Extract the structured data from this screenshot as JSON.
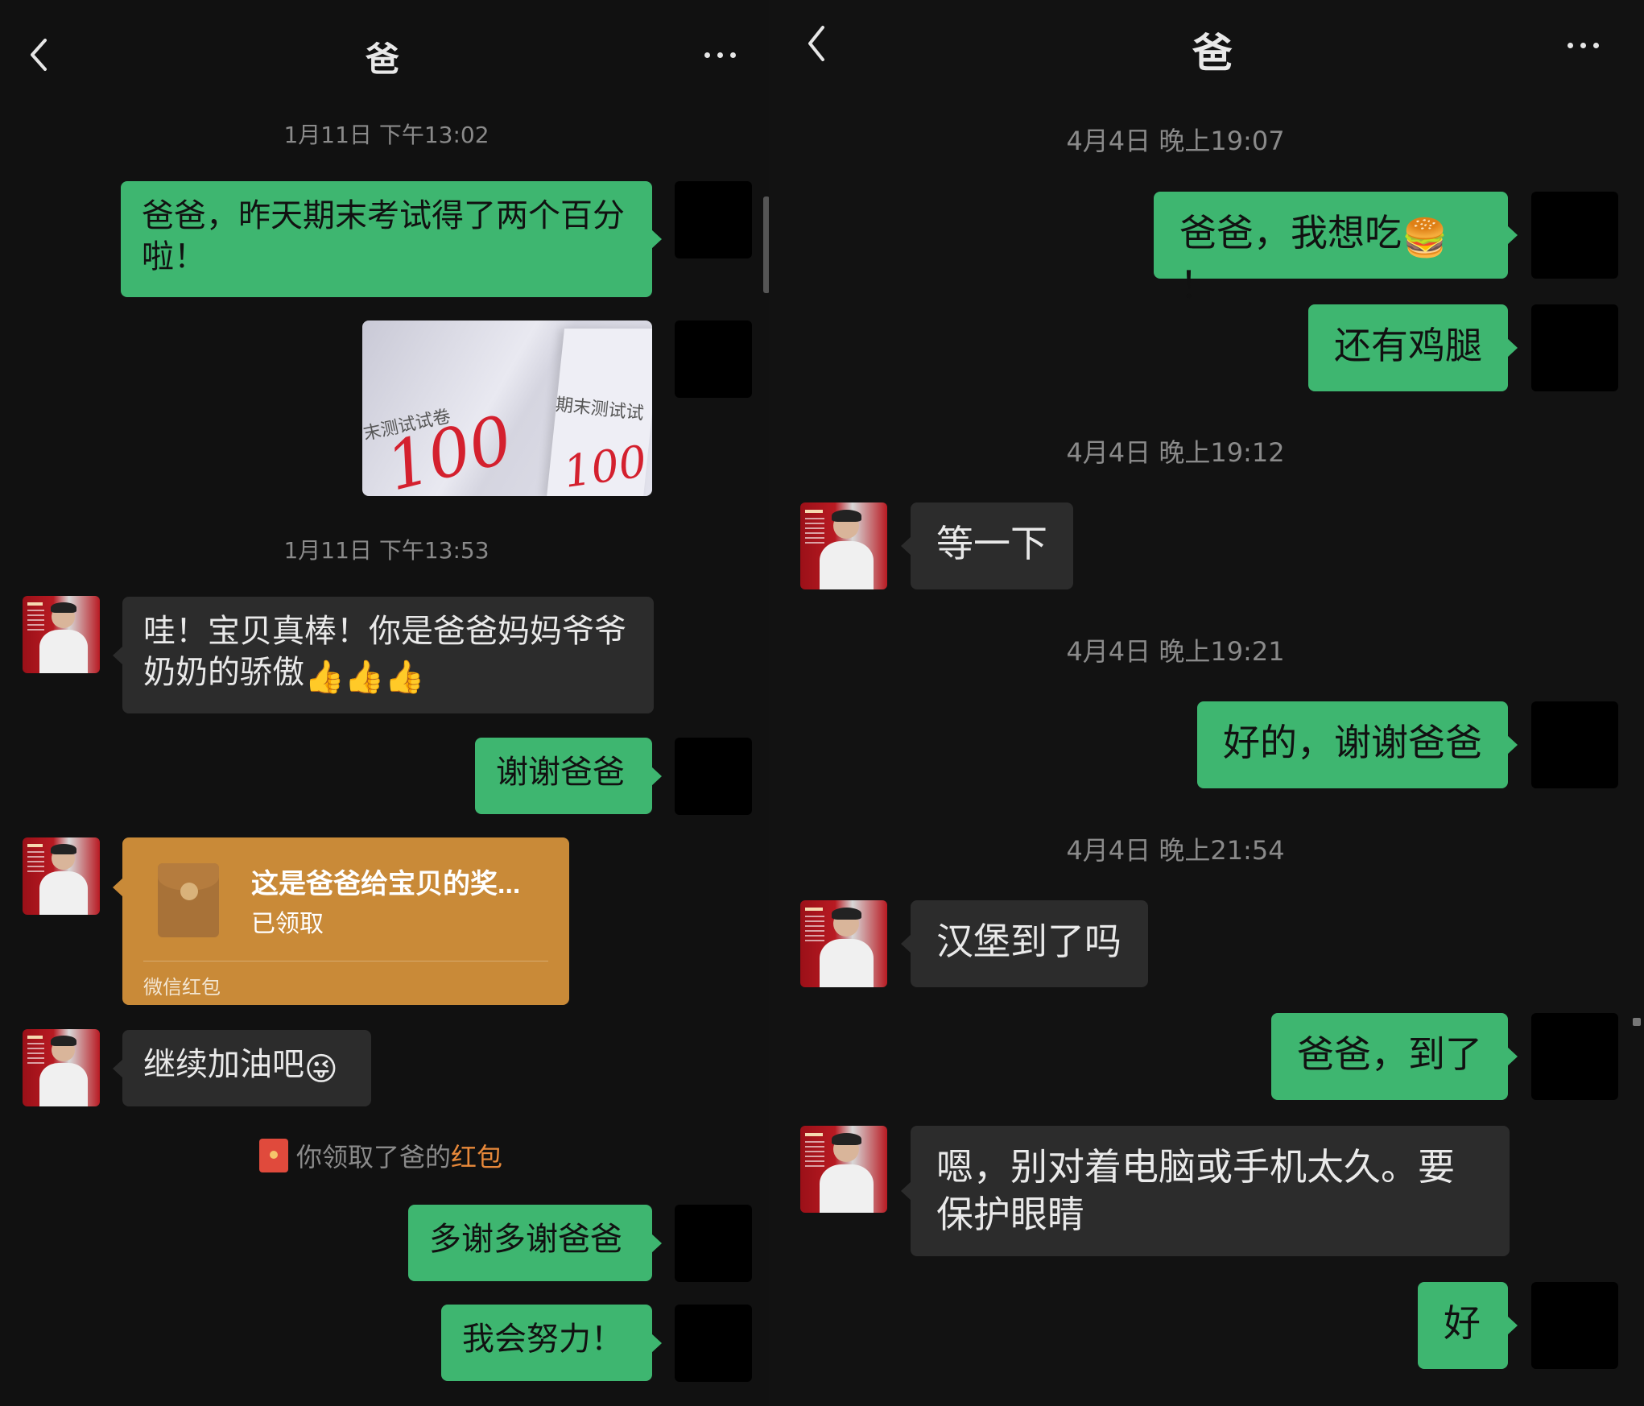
{
  "left": {
    "header": {
      "title": "爸"
    },
    "timestamps": [
      "1月11日 下午13:02",
      "1月11日 下午13:53"
    ],
    "messages": {
      "m1": "爸爸，昨天期末考试得了两个百分啦！",
      "m2_text": "哇！宝贝真棒！你是爸爸妈妈爷爷奶奶的骄傲",
      "m2_emoji": "👍👍👍",
      "m3": "谢谢爸爸",
      "m4_text": "继续加油吧",
      "m4_emoji": "😜",
      "m5": "多谢多谢爸爸",
      "m6": "我会努力！"
    },
    "photo": {
      "text_left": "末测试试卷",
      "text_right": "期末测试试",
      "score_left": "100",
      "score_right": "100"
    },
    "red_packet": {
      "title": "这是爸爸给宝贝的奖...",
      "status": "已领取",
      "footer": "微信红包"
    },
    "system_message": {
      "prefix": "你领取了爸的",
      "link": "红包"
    }
  },
  "right": {
    "header": {
      "title": "爸"
    },
    "timestamps": [
      "4月4日 晚上19:07",
      "4月4日 晚上19:12",
      "4月4日 晚上19:21",
      "4月4日 晚上21:54"
    ],
    "messages": {
      "m1_text": "爸爸，我想吃",
      "m1_emoji": "🍔",
      "m1_end": "！",
      "m2": "还有鸡腿",
      "m3": "等一下",
      "m4": "好的，谢谢爸爸",
      "m5": "汉堡到了吗",
      "m6": "爸爸，到了",
      "m7": "嗯，别对着电脑或手机太久。要保护眼睛",
      "m8": "好"
    }
  },
  "icons": {
    "back": "chevron-left-icon",
    "more": "more-dots-icon"
  },
  "colors": {
    "background": "#121212",
    "sent_bubble": "#3eb670",
    "received_bubble": "#2c2c2c",
    "red_packet": "#c98a38",
    "link": "#e8893a"
  }
}
